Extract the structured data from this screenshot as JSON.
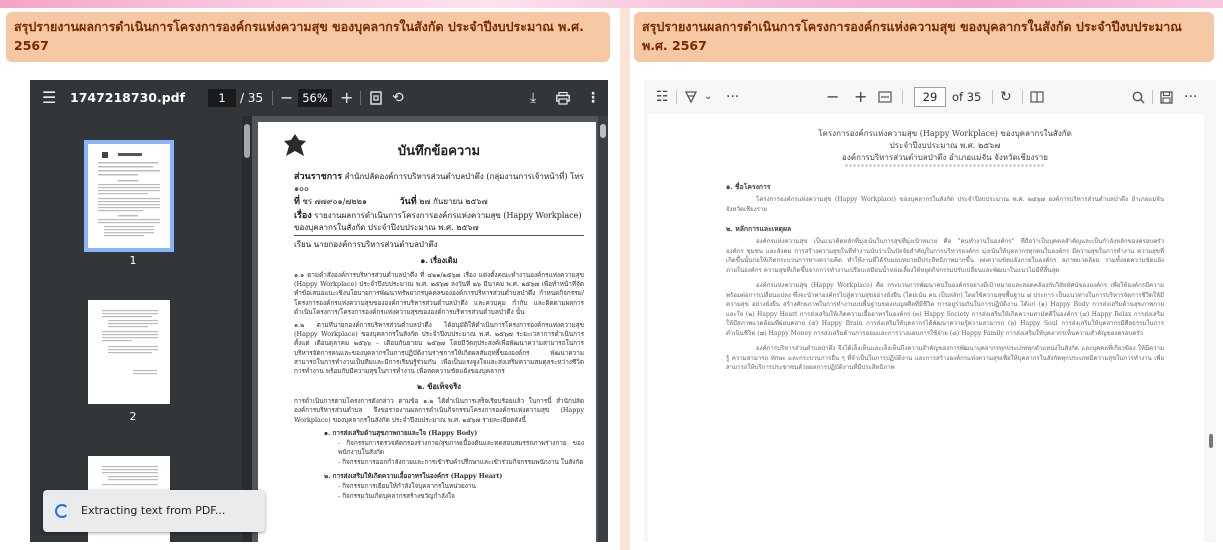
{
  "banner": {
    "text": "สรุปรายงานผลการดำเนินการโครงการองค์กรแห่งความสุข ของบุคลากรในสังกัด ประจำปีงบประมาณ พ.ศ. 2567"
  },
  "left_viewer": {
    "filename": "1747218730.pdf",
    "current_page": "1",
    "page_total": "/ 35",
    "zoom": "56%",
    "thumbnails": [
      {
        "label": "1"
      },
      {
        "label": "2"
      },
      {
        "label": ""
      }
    ],
    "toast": "Extracting text from PDF...",
    "document": {
      "title": "บันทึกข้อความ",
      "agency_label": "ส่วนราชการ",
      "agency_value": "สำนักปลัดองค์การบริหารส่วนตำบลป่าตึง (กลุ่มงานการเจ้าหน้าที่) โทร ๑๐๐",
      "ref_label": "ที่",
      "ref_value": "ชร ๗๗๙๐๑/๗๒๒๑",
      "date_label": "วันที่",
      "date_value": "๒๗ กันยายน ๒๕๖๗",
      "subject_label": "เรื่อง",
      "subject_value": "รายงานผลการดำเนินการโครงการองค์กรแห่งความสุข (Happy Workplace) ของบุคลากรในสังกัด ประจำปีงบประมาณ พ.ศ. ๒๕๖๗",
      "to_label": "เรียน",
      "to_value": "นายกองค์การบริหารส่วนตำบลป่าตึง",
      "section1": "๑. เรื่องเดิม",
      "para1": "๑.๑ ตามคำสั่งองค์การบริหารส่วนตำบลป่าตึง ที่ ๔๒๑/๒๕๖๗ เรื่อง แต่งตั้งคณะทำงานองค์กรแห่งความสุข (Happy Workplace) ประจำปีงบประมาณ พ.ศ. ๒๕๖๗ ลงวันที่ ๒๖ มีนาคม พ.ศ. ๒๕๖๗ เพื่อทำหน้าที่จัดทำข้อเสนอแนะเชิงนโยบายการพัฒนาทรัพยากรบุคคลขององค์การบริหารส่วนตำบลป่าตึง กำหนดกิจกรรม/โครงการองค์กรแห่งความสุขขององค์การบริหารส่วนตำบลป่าตึง และควบคุม กำกับ และติดตามผลการดำเนินโครงการ/โครงการองค์กรแห่งความสุขขององค์การบริหารส่วนตำบลป่าตึง นั้น",
      "para2": "๑.๒ ตามที่นายกองค์การบริหารส่วนตำบลป่าตึง ได้อนุมัติให้ดำเนินการโครงการองค์กรแห่งความสุข (Happy Workplace) ของบุคลากรในสังกัด ประจำปีงบประมาณ พ.ศ. ๒๕๖๗ ระยะเวลาการดำเนินการตั้งแต่ เดือนตุลาคม ๒๕๖๖ – เดือนกันยายน ๒๕๖๗ โดยมีวัตถุประสงค์เพื่อพัฒนาความสามารถในการบริหารจัดการคนและของบุคลากรในการปฏิบัติงานราชการให้เกิดผลสัมฤทธิ์ขององค์กร พัฒนาความสามารถในการทำงานเป็นทีมและมีการเรียนรู้ร่วมกัน เพื่อเป็นแรงจูงใจและส่งเสริมความสมดุลระหว่างชีวิตการทำงาน พร้อมกับมีความสุขในการทำงาน เพื่อลดความขัดแย้งของบุคลากร",
      "section2": "๒. ข้อเท็จจริง",
      "para3": "การดำเนินการตามโครงการดังกล่าว ตามข้อ ๑.๒ ได้ดำเนินการเสร็จเรียบร้อยแล้ว ในการนี้ สำนักปลัดองค์การบริหารส่วนตำบล จึงขอรายงานผลการดำเนินกิจกรรมโครงการองค์กรแห่งความสุข (Happy Workplace) ของบุคลากรในสังกัด ประจำปีงบประมาณ พ.ศ. ๒๕๖๗ รายละเอียดดังนี้",
      "list_a": "๑. การส่งเสริมด้านสุขภาพกายและใจ (Happy Body)",
      "list_a1": "- กิจกรรมการตรวจคัดกรองร่างกาย/สุขภาพเบื้องต้นและทดสอบสมรรถภาพร่างกาย ของพนักงานในสังกัด",
      "list_a2": "- กิจกรรมการออกกำลังกายและการเข้ารับคำปรึกษาและเข้าร่วมกิจกรรมพนักงาน ในสังกัด",
      "list_b": "๒. การส่งเสริมให้เกิดความเอื้ออาทรในองค์กร (Happy Heart)",
      "list_b1": "- กิจกรรมการเยี่ยมให้กำลังใจบุคลากรในหน่วยงาน",
      "list_b2": "- กิจกรรมวันเกิดบุคลากรสร้างขวัญกำลังใจ"
    }
  },
  "right_viewer": {
    "current_page": "29",
    "page_total": "of 35",
    "document": {
      "heading1": "โครงการองค์กรแห่งความสุข (Happy Workplace) ของบุคลากรในสังกัด",
      "heading2": "ประจำปีงบประมาณ พ.ศ. ๒๕๖๗",
      "heading3": "องค์การบริหารส่วนตำบลป่าตึง อำเภอแม่จัน จังหวัดเชียงราย",
      "dots": "**************************************************",
      "sec1": "๑. ชื่อโครงการ",
      "p1": "โครงการองค์กรแห่งความสุข (Happy Workplace) ของบุคลากรในสังกัด ประจำปีงบประมาณ พ.ศ. ๒๕๖๗ องค์การบริหารส่วนตำบลป่าตึง อำเภอแม่จัน จังหวัดเชียงราย",
      "sec2": "๒. หลักการและเหตุผล",
      "p2": "องค์กรแห่งความสุข เป็นแนวคิดหลักที่มุ่งเน้นในการสุขที่มุ่งเป้าหมาย คือ \"คนทำงานในองค์กร\" ที่ถือว่าเป็นบุคคลสำคัญและเป็นกำลังหลักของครอบครัว องค์กร ชุมชน และสังคม การสร้างความสุขในที่ทำงานนับว่าเป็นปัจจัยสำคัญในการบริหารองค์กร มุ่งเน้นให้บุคลากรทุกคนในองค์กร มีความสุขในการทำงาน ความสุขที่เกิดขึ้นนั้นก่อให้เกิดกระบวนการทางความคิด ทำให้งานที่ได้รับมอบหมายมีประสิทธิภาพมากขึ้น ลดความขัดแย้งภายในองค์กร สภาพแวดล้อม รวมทั้งลดความขัดแย้งภายในองค์กร ความสุขที่เกิดขึ้นจากการทำงานเปรียบเสมือนน้ำหล่อเลี้ยงให้หยุดกิจกรรมปรับเปลี่ยนและพัฒนาในแนวไม่มีที่สิ้นสุด",
      "p3": "องค์กรแห่งความสุข (Happy Workplace) คือ กระบวนการพัฒนาคนในองค์กรอย่างมีเป้าหมายและสอดคล้องกับวิสัยทัศน์ขององค์กร เพื่อให้องค์กรมีความพร้อมต่อการเปลี่ยนแปลง ซึ่งจะนำพาองค์กรไปสู่ความสุขอย่างยั่งยืน (โดยเน้น คน เป็นหลัก) โดยใช้ความสุขพื้นฐาน ๘ ประการ เป็นแนวทางในการบริหารจัดการชีวิตให้มีความสุข อย่างยั่งยืน สร้างศักยภาพในการทำงานบนพื้นฐานของเบญจศีลที่มีชีวิต การอยู่ร่วมกันในการปฏิบัติงาน ได้แก่ (๑) Happy Body การส่งเสริมด้านสุขภาพกายและใจ (๒) Happy Heart การส่งเสริมให้เกิดความเอื้ออาทรในองค์กร (๓) Happy Society การส่งเสริมให้เกิดความสามัคคีในองค์กร (๔) Happy Relax การส่งเสริมให้มีสภาพแวดล้อมที่ผ่อนคลาย (๕) Happy Brain การส่งเสริมให้บุคลากรได้พัฒนาความรู้ความสามารถ (๖) Happy Soul การส่งเสริมให้บุคลากรมีศีลธรรมในการดำเนินชีวิต (๗) Happy Money การส่งเสริมด้านการออมและการวางแผนการใช้จ่าย (๘) Happy Family การส่งเสริมให้บุคลากรเห็นความสำคัญของครอบครัว",
      "p4": "องค์การบริหารส่วนตำบลป่าตึง จึงได้เล็งเห็นและเล็งเห็นถึงความสำคัญของการพัฒนาบุคลากรทุกประเภททุกตำแหน่งในสังกัด และบุคคลที่เกี่ยวข้อง ให้มีความรู้ ความสามารถ ทักษะ และกระบวนการอื่น ๆ ที่จำเป็นในการปฏิบัติงาน และการสร้างองค์กรแห่งความสุขเพื่อให้บุคลากรในสังกัดทุกประเภทมีความสุขในการทำงาน เพื่อสามารถให้บริการประชาชนด้วยผลการปฏิบัติงานที่มีประสิทธิภาพ"
    }
  }
}
